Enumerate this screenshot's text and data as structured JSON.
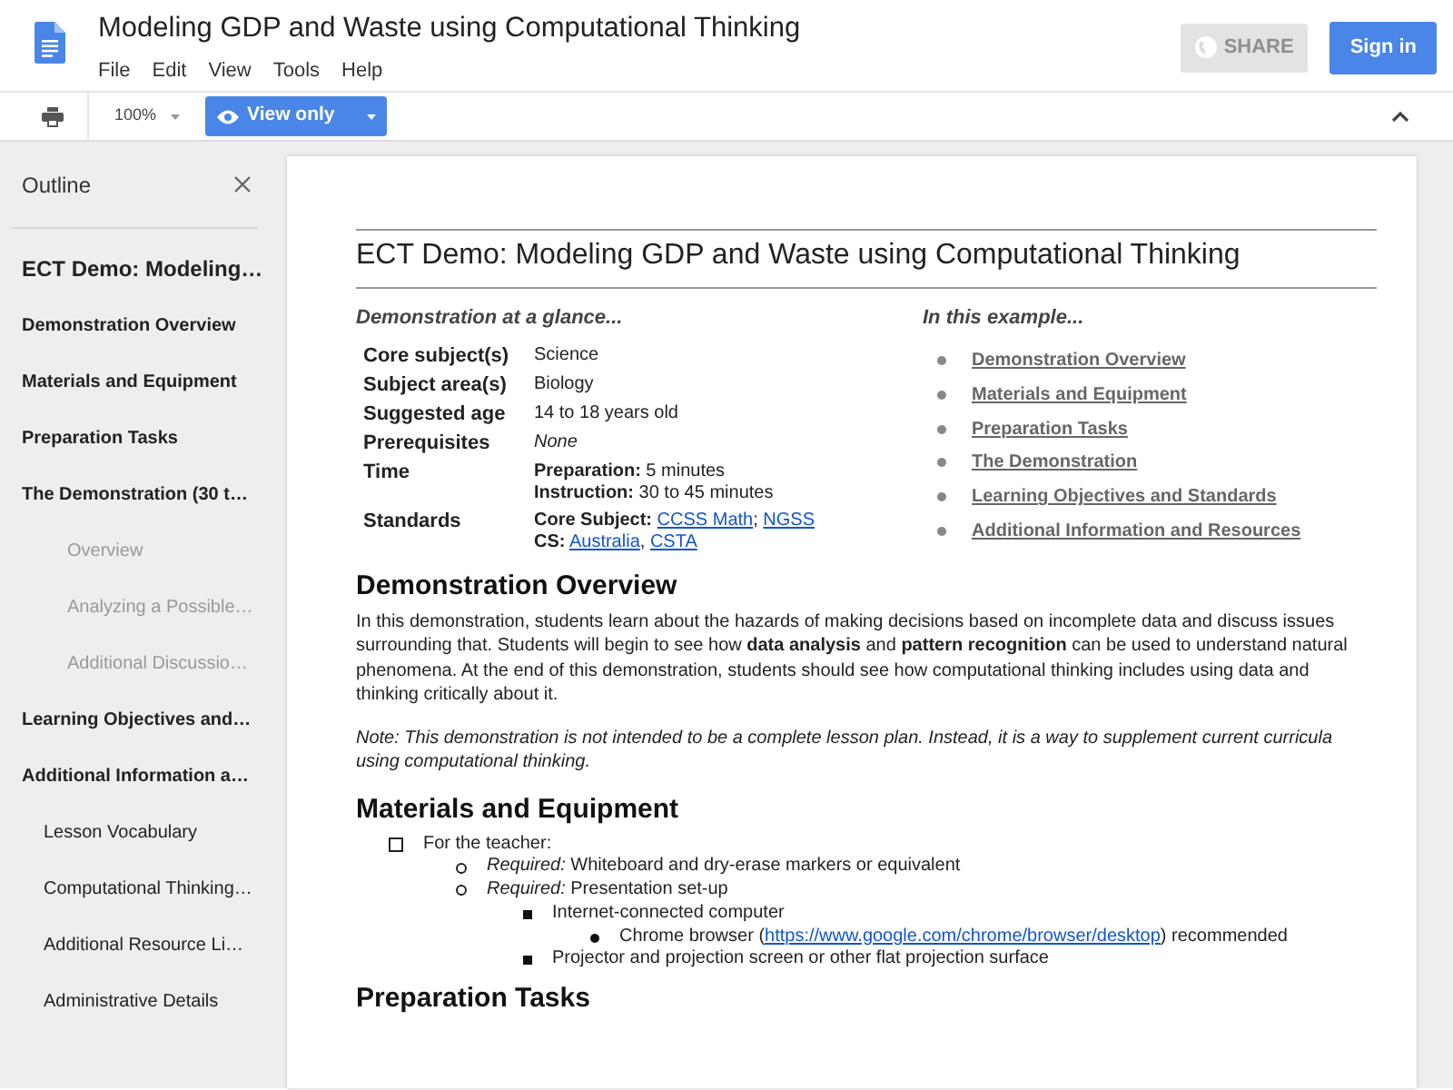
{
  "header": {
    "title": "Modeling GDP and Waste using Computational Thinking",
    "menu": [
      "File",
      "Edit",
      "View",
      "Tools",
      "Help"
    ],
    "share_button": {
      "label": "SHARE",
      "disabled": true
    },
    "sign_in_button": "Sign in"
  },
  "toolbar": {
    "zoom": "100%",
    "mode_button": "View only"
  },
  "outline": {
    "title": "Outline",
    "items": [
      {
        "label": "ECT Demo: Modeling…",
        "kind": "title"
      },
      {
        "label": "Demonstration Overview",
        "kind": "heading"
      },
      {
        "label": "Materials and Equipment",
        "kind": "heading"
      },
      {
        "label": "Preparation Tasks",
        "kind": "heading"
      },
      {
        "label": "The Demonstration (30 t…",
        "kind": "heading",
        "children": [
          {
            "label": "Overview",
            "kind": "minor"
          },
          {
            "label": "Analyzing a Possible…",
            "kind": "minor"
          },
          {
            "label": "Additional Discussio…",
            "kind": "minor"
          }
        ]
      },
      {
        "label": "Learning Objectives and…",
        "kind": "heading"
      },
      {
        "label": "Additional Information a…",
        "kind": "heading",
        "children": [
          {
            "label": "Lesson Vocabulary",
            "kind": "sub"
          },
          {
            "label": "Computational Thinking…",
            "kind": "sub"
          },
          {
            "label": "Additional Resource Li…",
            "kind": "sub"
          },
          {
            "label": "Administrative Details",
            "kind": "sub"
          }
        ]
      }
    ]
  },
  "document": {
    "title": "ECT Demo: Modeling GDP and Waste using Computational Thinking",
    "glance": {
      "heading": "Demonstration at a glance...",
      "rows": [
        {
          "label": "Core subject(s)",
          "lines": [
            [
              {
                "text": "Science"
              }
            ]
          ]
        },
        {
          "label": "Subject area(s)",
          "lines": [
            [
              {
                "text": "Biology"
              }
            ]
          ]
        },
        {
          "label": "Suggested age",
          "lines": [
            [
              {
                "text": "14 to 18 years old"
              }
            ]
          ]
        },
        {
          "label": "Prerequisites",
          "lines": [
            [
              {
                "text": "*None*"
              }
            ]
          ]
        },
        {
          "label": "Time",
          "lines": [
            [
              {
                "text": "**Preparation:** 5 minutes"
              }
            ],
            [
              {
                "text": "**Instruction:** 30 to 45 minutes"
              }
            ]
          ]
        },
        {
          "label": "Standards",
          "lines": [
            [
              {
                "text": "**Core Subject:** "
              },
              {
                "link": "CCSS Math"
              },
              {
                "text": "; "
              },
              {
                "link": "NGSS"
              }
            ],
            [
              {
                "text": "**CS:** "
              },
              {
                "link": "Australia"
              },
              {
                "text": ", "
              },
              {
                "link": "CSTA"
              }
            ]
          ]
        }
      ]
    },
    "example": {
      "heading": "In this example...",
      "links": [
        "Demonstration Overview",
        "Materials and Equipment",
        "Preparation Tasks",
        "The Demonstration",
        "Learning Objectives and Standards",
        "Additional Information and Resources"
      ]
    },
    "sections": [
      {
        "heading": "Demonstration Overview",
        "paragraphs": [
          {
            "text": "In this demonstration, students learn about the hazards of making decisions based on incomplete data and discuss issues surrounding that. Students will begin to see how **data analysis** and **pattern recognition** can be used to understand natural phenomena. At the end of this demonstration, students should see how computational thinking includes using data and thinking critically about it.",
            "italic": false
          },
          {
            "text": "Note: This demonstration is not intended to be a complete lesson plan. Instead, it is a way to supplement current curricula using computational thinking.",
            "italic": true
          }
        ]
      },
      {
        "heading": "Materials and Equipment",
        "list": [
          {
            "parts": [
              {
                "text": "For the teacher:"
              }
            ],
            "children": [
              {
                "parts": [
                  {
                    "text": "*Required:* Whiteboard and dry-erase markers or equivalent"
                  }
                ]
              },
              {
                "parts": [
                  {
                    "text": "*Required:* Presentation set-up"
                  }
                ],
                "children": [
                  {
                    "parts": [
                      {
                        "text": "Internet-connected computer"
                      }
                    ],
                    "children": [
                      {
                        "parts": [
                          {
                            "text": "Chrome browser ("
                          },
                          {
                            "link": "https://www.google.com/chrome/browser/desktop"
                          },
                          {
                            "text": ") recommended"
                          }
                        ]
                      }
                    ]
                  },
                  {
                    "parts": [
                      {
                        "text": "Projector and projection screen or other flat projection surface"
                      }
                    ]
                  }
                ]
              }
            ]
          }
        ]
      },
      {
        "heading": "Preparation Tasks"
      }
    ]
  }
}
